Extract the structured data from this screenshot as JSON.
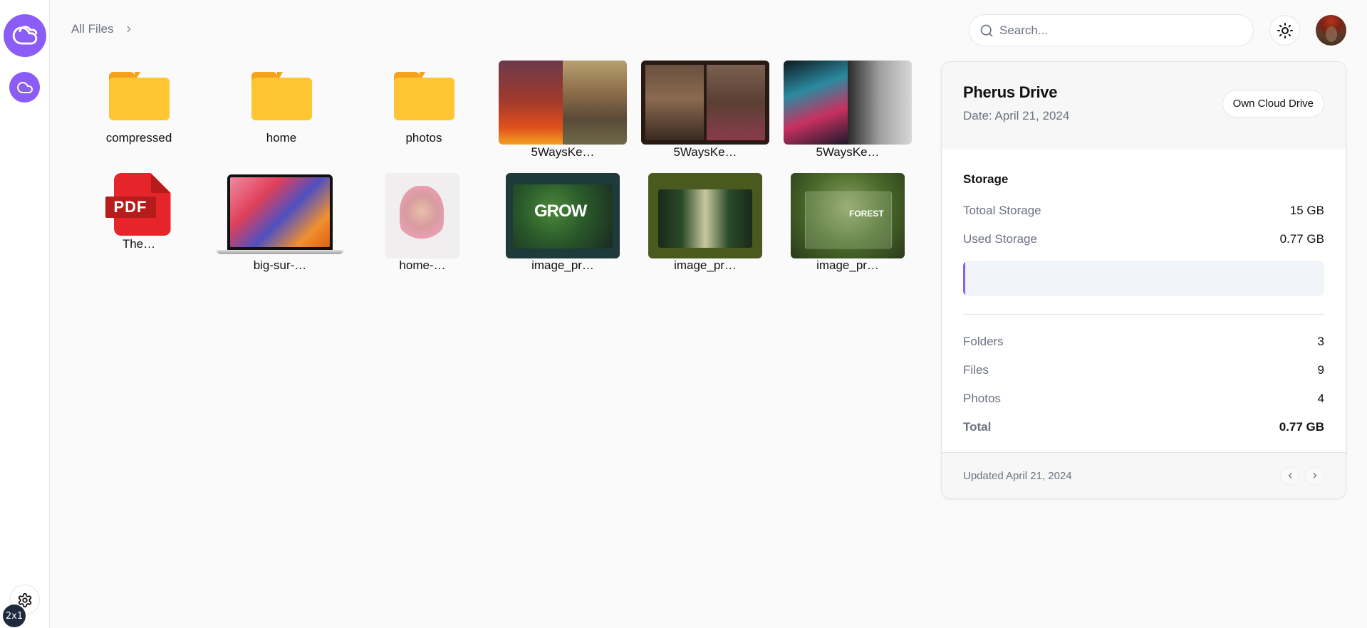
{
  "sidebar": {
    "logo_icon": "cloud-icon",
    "nav_items": [
      {
        "icon": "cloud-icon",
        "label": "Drive"
      }
    ],
    "settings_icon": "gear-icon",
    "scale_badge": "2x1"
  },
  "header": {
    "breadcrumb": [
      {
        "label": "All Files"
      }
    ],
    "search": {
      "placeholder": "Search...",
      "value": ""
    },
    "theme_icon": "sun-icon",
    "avatar_icon": "user-avatar"
  },
  "files": [
    {
      "type": "folder",
      "name": "compressed"
    },
    {
      "type": "folder",
      "name": "home"
    },
    {
      "type": "folder",
      "name": "photos"
    },
    {
      "type": "image",
      "name": "5WaysKe…"
    },
    {
      "type": "image",
      "name": "5WaysKe…"
    },
    {
      "type": "image",
      "name": "5WaysKe…"
    },
    {
      "type": "pdf",
      "name": "The…",
      "icon_label": "PDF"
    },
    {
      "type": "image",
      "name": "big-sur-…"
    },
    {
      "type": "image",
      "name": "home-…"
    },
    {
      "type": "image",
      "name": "image_pr…"
    },
    {
      "type": "image",
      "name": "image_pr…"
    },
    {
      "type": "image",
      "name": "image_pr…"
    }
  ],
  "panel": {
    "title": "Pherus Drive",
    "date": "Date: April 21, 2024",
    "badge": "Own Cloud Drive",
    "storage": {
      "title": "Storage",
      "total_label": "Totoal Storage",
      "total_value": "15 GB",
      "used_label": "Used Storage",
      "used_value": "0.77 GB",
      "used_fraction": 0.0513,
      "bar_color": "#8b5cf6"
    },
    "stats": [
      {
        "label": "Folders",
        "value": "3"
      },
      {
        "label": "Files",
        "value": "9"
      },
      {
        "label": "Photos",
        "value": "4"
      }
    ],
    "total": {
      "label": "Total",
      "value": "0.77 GB"
    },
    "footer": "Updated April 21, 2024"
  },
  "colors": {
    "accent": "#8b5cf6",
    "folder": "#ffc533",
    "folder_tab": "#f5a11c",
    "pdf": "#e5252a"
  }
}
